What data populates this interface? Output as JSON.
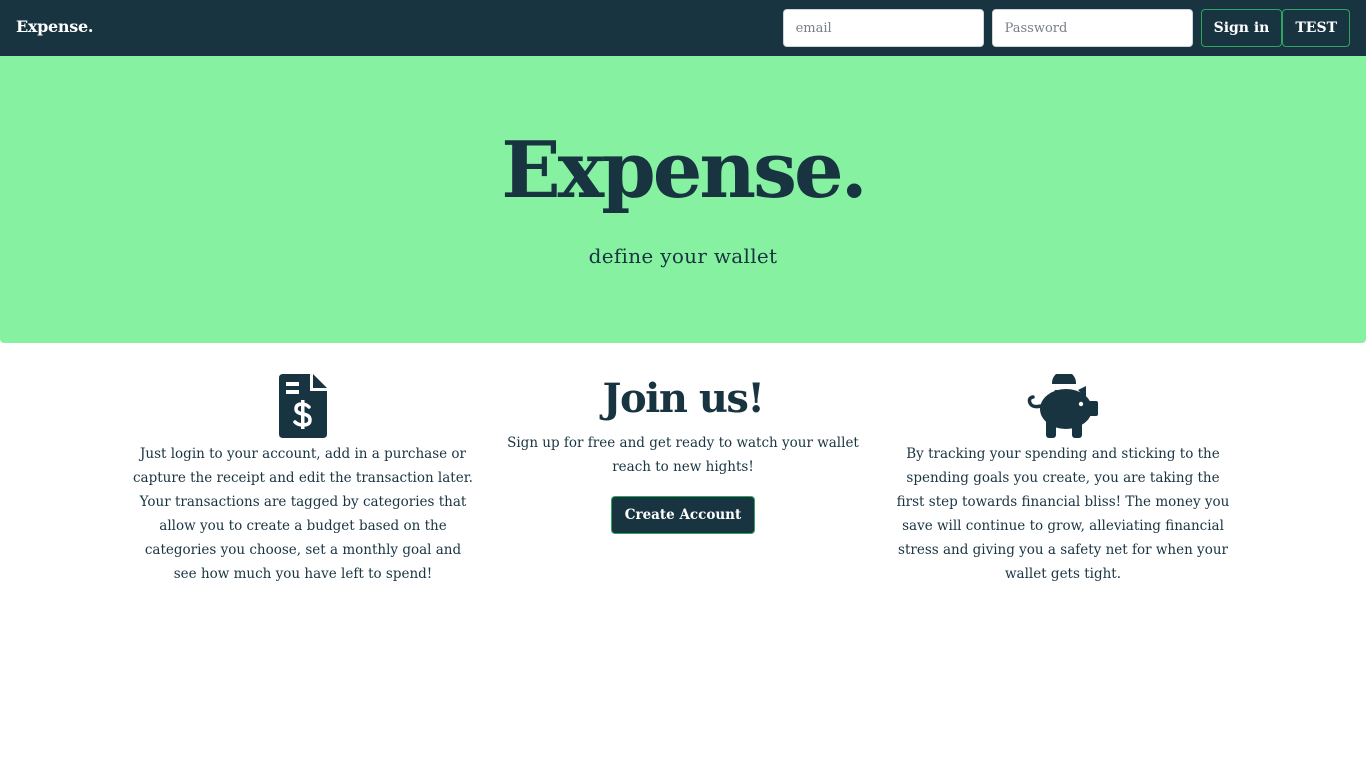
{
  "navbar": {
    "brand": "Expense.",
    "email_placeholder": "email",
    "password_placeholder": "Password",
    "signin_label": "Sign in",
    "test_label": "TEST"
  },
  "hero": {
    "title": "Expense.",
    "subtitle": "define your wallet"
  },
  "features": {
    "left": {
      "icon": "file-invoice-dollar-icon",
      "text": "Just login to your account, add in a purchase or capture the receipt and edit the transaction later. Your transactions are tagged by categories that allow you to create a budget based on the categories you choose, set a monthly goal and see how much you have left to spend!"
    },
    "middle": {
      "title": "Join us!",
      "text": "Sign up for free and get ready to watch your wallet reach to new hights!",
      "button_label": "Create Account"
    },
    "right": {
      "icon": "piggy-bank-icon",
      "text": "By tracking your spending and sticking to the spending goals you create, you are taking the first step towards financial bliss! The money you save will continue to grow, alleviating financial stress and giving you a safety net for when your wallet gets tight."
    }
  },
  "colors": {
    "navbar_bg": "#193441",
    "hero_bg": "#86f2a1",
    "accent_border": "#2fa360",
    "text": "#193441"
  }
}
